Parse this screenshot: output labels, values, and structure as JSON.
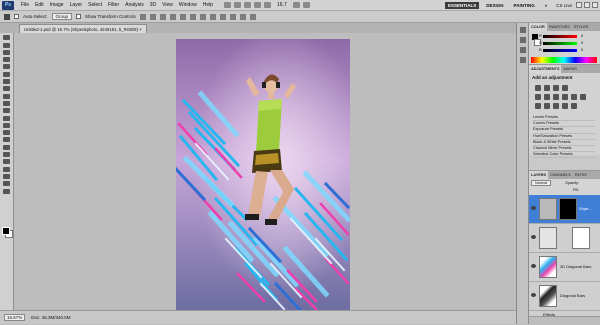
{
  "app": {
    "logo": "Ps"
  },
  "menu": [
    "File",
    "Edit",
    "Image",
    "Layer",
    "Select",
    "Filter",
    "Analysis",
    "3D",
    "View",
    "Window",
    "Help"
  ],
  "zoom_menu": "16.7",
  "workspaces": {
    "active": "ESSENTIALS",
    "items": [
      "DESIGN",
      "PAINTING"
    ],
    "more": "»"
  },
  "cs_live": "CS Live",
  "options": {
    "auto_select_label": "Auto-Select:",
    "auto_select_value": "Group",
    "transform_label": "Show Transform Controls"
  },
  "document_tab": "Untitled-1.psd @ 16.7% (Shpenkphoto, 4248181, 5_RGB/8) ×",
  "status": {
    "zoom": "16.67%",
    "doc": "Doc: 46.3M/340.0M"
  },
  "color_panel": {
    "tabs": [
      "COLOR",
      "SWATCHES",
      "STYLES"
    ],
    "rows": [
      "R",
      "G",
      "B"
    ],
    "values": [
      "0",
      "0",
      "0"
    ]
  },
  "adjustments": {
    "tabs": [
      "ADJUSTMENTS",
      "MASKS"
    ],
    "title": "Add an adjustment",
    "presets": [
      "Levels Presets",
      "Curves Presets",
      "Exposure Presets",
      "Hue/Saturation Presets",
      "Black & White Presets",
      "Channel Mixer Presets",
      "Selective Color Presets"
    ]
  },
  "layers": {
    "tabs": [
      "LAYERS",
      "CHANNELS",
      "PATHS"
    ],
    "blend_mode": "Normal",
    "opacity_label": "Opacity:",
    "fill_label": "Fill:",
    "items": [
      {
        "name": "Shpe..."
      },
      {
        "name": ""
      },
      {
        "name": "3D Diagonal Bars"
      },
      {
        "name": "Diagonal Bars"
      }
    ],
    "effects_label": "Effects",
    "effect_item": "Gradient Overlay"
  },
  "colors": {
    "selected_layer": "#3f7fd6",
    "accent": "#2a9bd9"
  }
}
